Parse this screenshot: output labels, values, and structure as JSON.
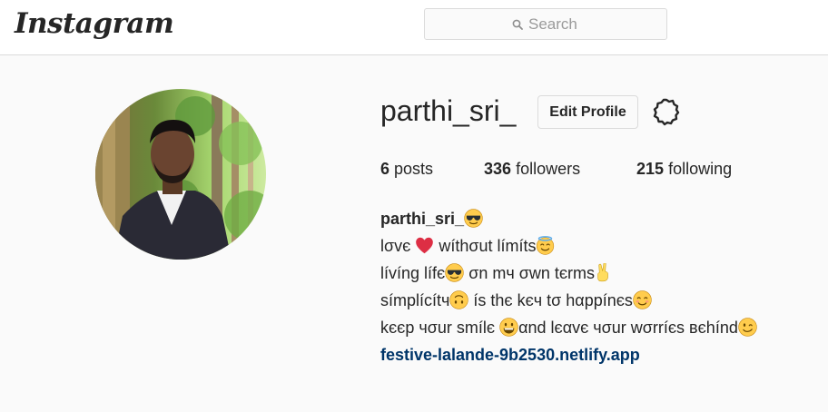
{
  "header": {
    "logo_text": "Instagram",
    "search_placeholder": "Search"
  },
  "profile": {
    "username": "parthi_sri_",
    "edit_button": "Edit Profile",
    "stats": {
      "posts_count": "6",
      "posts_label": "posts",
      "followers_count": "336",
      "followers_label": "followers",
      "following_count": "215",
      "following_label": "following"
    },
    "bio": {
      "full_name": "parthi_sri_",
      "line1_a": "lσvє",
      "line1_b": "wíthσut límíts",
      "line2_a": "lívíng lífє",
      "line2_b": "σn mч σwn tєrms",
      "line3_a": "símplícítч",
      "line3_b": "ís thє kєч tσ hαppínєs",
      "line4_a": "kєєp чσur smílє",
      "line4_b": "αnd lєαvє чσur wσrríєs вєhínd",
      "website": "festive-lalande-9b2530.netlify.app"
    }
  },
  "colors": {
    "link": "#003569",
    "text": "#262626",
    "border": "#dbdbdb",
    "background": "#fafafa",
    "heart": "#e0245e",
    "emoji": "#ffcc4d"
  }
}
